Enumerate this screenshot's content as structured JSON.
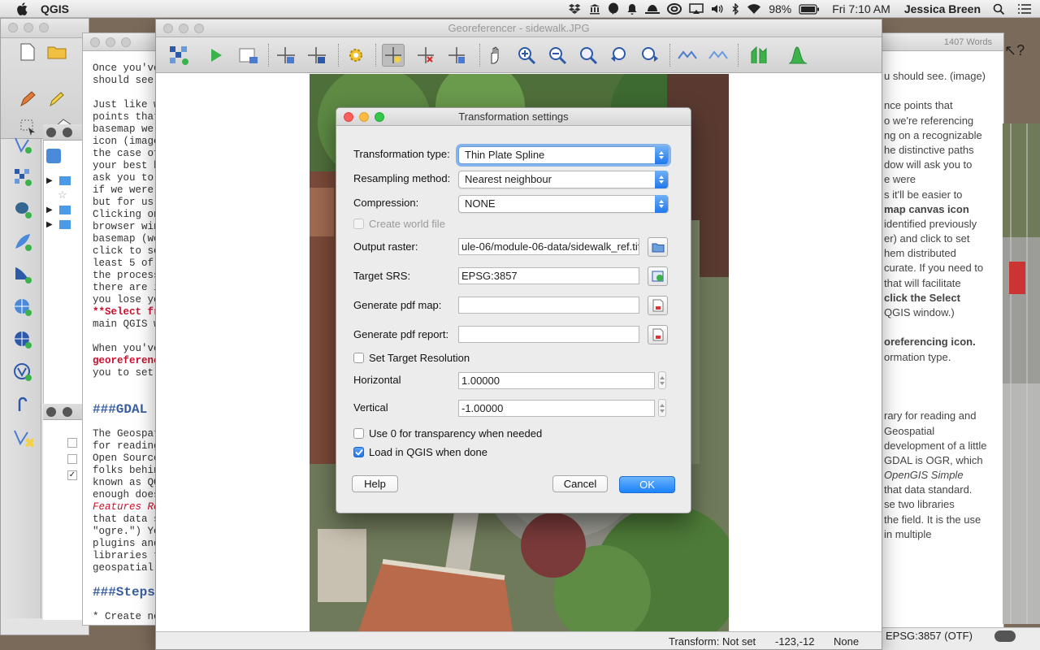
{
  "menubar": {
    "app_name": "QGIS",
    "battery": "98%",
    "clock": "Fri 7:10 AM",
    "user": "Jessica Breen"
  },
  "editor": {
    "lines": [
      "Once you've",
      "should see.",
      "",
      "Just like w",
      "points that",
      "basemap we'",
      "icon (image",
      "the case of",
      "your best b",
      "ask you to",
      "if we were",
      "but for us",
      "Clicking on",
      "browser win",
      "basemap (we",
      "click to se",
      "least 5 of",
      "the process",
      "there are i",
      "you lose yo",
      "**Select fr",
      "main QGIS w",
      "",
      "When you've",
      "georeferenc",
      "you to set",
      "",
      "",
      "###GDAL",
      "",
      "The Geospat",
      "for reading",
      "Open Source",
      "folks behin",
      "known as QG",
      "enough does",
      "Features Re",
      "that data s",
      "\"ogre.\") Yo",
      "plugins and",
      "libraries t",
      "geospatial",
      "",
      "###Steps",
      "",
      "* Create ne"
    ]
  },
  "word_panel": {
    "word_count": "1407 Words",
    "lines": [
      "u should see. (image)",
      "",
      "nce points that",
      "o we're referencing",
      "ng on a recognizable",
      "he distinctive paths",
      "dow will ask you to",
      "e were",
      "s it'll be easier to",
      "map canvas icon",
      "identified previously",
      "er) and click to set",
      "hem distributed",
      "curate. If you need to",
      "that will facilitate",
      "click the Select",
      "QGIS window.)",
      "",
      "oreferencing icon.",
      "ormation type.",
      "",
      "",
      "",
      "rary for reading and",
      "Geospatial",
      "development of a little",
      "GDAL is OGR, which",
      "OpenGIS Simple",
      "that data standard.",
      "se two libraries",
      "the field. It is the use",
      "in multiple"
    ]
  },
  "georeferencer": {
    "title": "Georeferencer - sidewalk.JPG",
    "status": {
      "transform": "Transform: Not set",
      "coords": "-123,-12",
      "units": "None"
    }
  },
  "qgis_status": {
    "crs": "EPSG:3857 (OTF)"
  },
  "dialog": {
    "title": "Transformation settings",
    "transformation_type_label": "Transformation type:",
    "transformation_type_value": "Thin Plate Spline",
    "resampling_label": "Resampling method:",
    "resampling_value": "Nearest neighbour",
    "compression_label": "Compression:",
    "compression_value": "NONE",
    "world_file_label": "Create world file",
    "output_raster_label": "Output raster:",
    "output_raster_value": "ule-06/module-06-data/sidewalk_ref.tif",
    "target_srs_label": "Target SRS:",
    "target_srs_value": "EPSG:3857",
    "pdf_map_label": "Generate pdf map:",
    "pdf_report_label": "Generate pdf report:",
    "set_resolution_label": "Set Target Resolution",
    "horizontal_label": "Horizontal",
    "horizontal_value": "1.00000",
    "vertical_label": "Vertical",
    "vertical_value": "-1.00000",
    "transparency_label": "Use 0 for transparency when needed",
    "load_label": "Load in QGIS when done",
    "help": "Help",
    "cancel": "Cancel",
    "ok": "OK"
  },
  "colors": {
    "accent": "#1a82fb",
    "editor_red": "#c8102e"
  }
}
